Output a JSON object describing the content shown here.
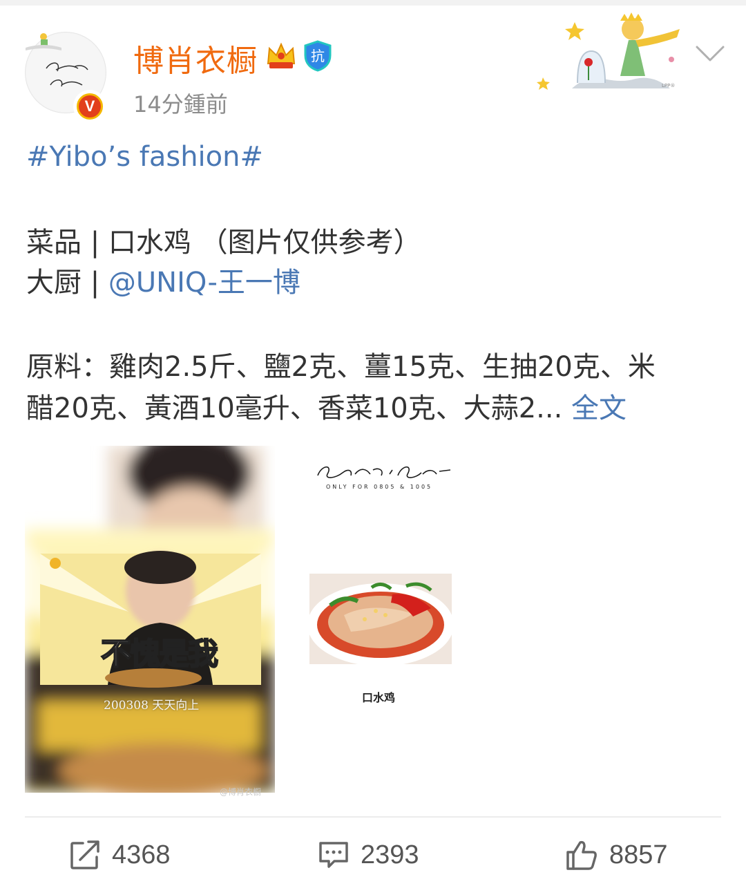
{
  "post": {
    "author": {
      "name": "博肖衣橱",
      "verified_badge": "V",
      "anti_badge": "抗"
    },
    "timestamp": "14分鍾前",
    "hashtag": "#Yibo’s fashion#",
    "dish_line": "菜品 | 口水鸡 （图片仅供参考）",
    "chef_prefix": "大厨 | ",
    "chef_mention": "@UNIQ-王一博",
    "ingredients_line1": "原料：雞肉2.5斤、鹽2克、薑15克、生抽20克、米",
    "ingredients_line2": "醋20克、黃酒10毫升、香菜10克、大蒜2...",
    "full_text_link": "全文"
  },
  "images": {
    "left": {
      "overlay_text": "不愧是我",
      "caption": "200308 天天向上"
    },
    "right": {
      "logo_sub": "ONLY FOR 0805 & 1005",
      "dish_label": "口水鸡",
      "watermark": "@博肖衣橱"
    }
  },
  "actions": {
    "repost": {
      "count": "4368",
      "icon": "share-icon"
    },
    "comment": {
      "count": "2393",
      "icon": "comment-icon"
    },
    "like": {
      "count": "8857",
      "icon": "thumbs-up-icon"
    }
  },
  "colors": {
    "username": "#f06a0f",
    "link": "#4a78b4",
    "body_text": "#333333",
    "meta": "#8c8c8c"
  }
}
